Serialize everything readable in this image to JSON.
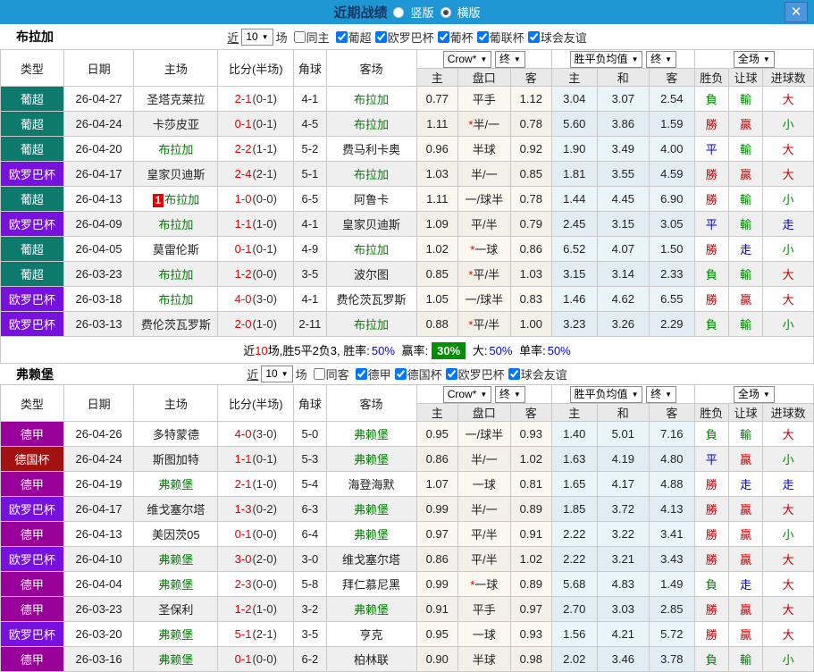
{
  "titlebar": {
    "title": "近期战绩",
    "vertical_label": "竖版",
    "horizontal_label": "横版",
    "close_glyph": "✕"
  },
  "labels": {
    "near": "近",
    "games": "场"
  },
  "dropdowns": {
    "bookmaker": "Crow*",
    "final_a": "终",
    "avg": "胜平负均值",
    "final_b": "终",
    "scope": "全场"
  },
  "columns": {
    "type": "类型",
    "date": "日期",
    "home": "主场",
    "score": "比分(半场)",
    "corner": "角球",
    "away": "客场",
    "o_home": "主",
    "o_hcap": "盘口",
    "o_away": "客",
    "e_home": "主",
    "e_draw": "和",
    "e_away": "客",
    "r_wdl": "胜负",
    "r_hcap": "让球",
    "r_goals": "进球数"
  },
  "league_colors": {
    "葡超": "#0E7A6E",
    "欧罗巴杯": "#7711DD",
    "德甲": "#990099",
    "德国杯": "#A31212"
  },
  "result_colors": {
    "勝": "#CC0000",
    "贏": "#CC0000",
    "大": "#CC0000",
    "負": "#008800",
    "輸": "#008800",
    "小": "#008800",
    "平": "#0000CC",
    "走": "#0000CC"
  },
  "sections": [
    {
      "team": "布拉加",
      "filter": {
        "count": "10",
        "same": "同主",
        "same_checked": false,
        "leagues": [
          {
            "label": "葡超",
            "checked": true
          },
          {
            "label": "欧罗巴杯",
            "checked": true
          },
          {
            "label": "葡杯",
            "checked": true
          },
          {
            "label": "葡联杯",
            "checked": true
          },
          {
            "label": "球会友谊",
            "checked": true
          }
        ]
      },
      "rows": [
        {
          "league": "葡超",
          "date": "26-04-27",
          "home": "圣塔克莱拉",
          "away": "布拉加",
          "ft": "2-1",
          "ht": "0-1",
          "corner": "4-1",
          "o": [
            "0.77",
            "平手",
            "1.12"
          ],
          "e": [
            "3.04",
            "3.07",
            "2.54"
          ],
          "res": [
            "負",
            "輸",
            "大"
          ]
        },
        {
          "league": "葡超",
          "date": "26-04-24",
          "home": "卡莎皮亚",
          "away": "布拉加",
          "ft": "0-1",
          "ht": "0-1",
          "corner": "4-5",
          "o": [
            "1.11",
            "*半/一",
            "0.78"
          ],
          "e": [
            "5.60",
            "3.86",
            "1.59"
          ],
          "res": [
            "勝",
            "贏",
            "小"
          ]
        },
        {
          "league": "葡超",
          "date": "26-04-20",
          "home": "布拉加",
          "away": "费马利卡奥",
          "ft": "2-2",
          "ht": "1-1",
          "corner": "5-2",
          "o": [
            "0.96",
            "半球",
            "0.92"
          ],
          "e": [
            "1.90",
            "3.49",
            "4.00"
          ],
          "res": [
            "平",
            "輸",
            "大"
          ]
        },
        {
          "league": "欧罗巴杯",
          "date": "26-04-17",
          "home": "皇家贝迪斯",
          "away": "布拉加",
          "ft": "2-4",
          "ht": "2-1",
          "corner": "5-1",
          "o": [
            "1.03",
            "半/一",
            "0.85"
          ],
          "e": [
            "1.81",
            "3.55",
            "4.59"
          ],
          "res": [
            "勝",
            "贏",
            "大"
          ]
        },
        {
          "league": "葡超",
          "date": "26-04-13",
          "home": "布拉加",
          "home_mark": "1",
          "away": "阿鲁卡",
          "ft": "1-0",
          "ht": "0-0",
          "corner": "6-5",
          "o": [
            "1.11",
            "一/球半",
            "0.78"
          ],
          "e": [
            "1.44",
            "4.45",
            "6.90"
          ],
          "res": [
            "勝",
            "輸",
            "小"
          ]
        },
        {
          "league": "欧罗巴杯",
          "date": "26-04-09",
          "home": "布拉加",
          "away": "皇家贝迪斯",
          "ft": "1-1",
          "ht": "1-0",
          "corner": "4-1",
          "o": [
            "1.09",
            "平/半",
            "0.79"
          ],
          "e": [
            "2.45",
            "3.15",
            "3.05"
          ],
          "res": [
            "平",
            "輸",
            "走"
          ]
        },
        {
          "league": "葡超",
          "date": "26-04-05",
          "home": "莫雷伦斯",
          "away": "布拉加",
          "ft": "0-1",
          "ht": "0-1",
          "corner": "4-9",
          "o": [
            "1.02",
            "*一球",
            "0.86"
          ],
          "e": [
            "6.52",
            "4.07",
            "1.50"
          ],
          "res": [
            "勝",
            "走",
            "小"
          ]
        },
        {
          "league": "葡超",
          "date": "26-03-23",
          "home": "布拉加",
          "away": "波尔图",
          "ft": "1-2",
          "ht": "0-0",
          "corner": "3-5",
          "o": [
            "0.85",
            "*平/半",
            "1.03"
          ],
          "e": [
            "3.15",
            "3.14",
            "2.33"
          ],
          "res": [
            "負",
            "輸",
            "大"
          ]
        },
        {
          "league": "欧罗巴杯",
          "date": "26-03-18",
          "home": "布拉加",
          "away": "费伦茨瓦罗斯",
          "ft": "4-0",
          "ht": "3-0",
          "corner": "4-1",
          "o": [
            "1.05",
            "一/球半",
            "0.83"
          ],
          "e": [
            "1.46",
            "4.62",
            "6.55"
          ],
          "res": [
            "勝",
            "贏",
            "大"
          ]
        },
        {
          "league": "欧罗巴杯",
          "date": "26-03-13",
          "home": "费伦茨瓦罗斯",
          "away": "布拉加",
          "ft": "2-0",
          "ht": "1-0",
          "corner": "2-11",
          "o": [
            "0.88",
            "*平/半",
            "1.00"
          ],
          "e": [
            "3.23",
            "3.26",
            "2.29"
          ],
          "res": [
            "負",
            "輸",
            "小"
          ]
        }
      ],
      "summary": {
        "p1": "近",
        "count": "10",
        "p2": "场,胜5平2负3, 胜率:",
        "v1": "50%",
        "p3": "赢率:",
        "badge": "30%",
        "p4": "大:",
        "v2": "50%",
        "p5": "单率:",
        "v3": "50%"
      }
    },
    {
      "team": "弗赖堡",
      "filter": {
        "count": "10",
        "same": "同客",
        "same_checked": false,
        "leagues": [
          {
            "label": "德甲",
            "checked": true
          },
          {
            "label": "德国杯",
            "checked": true
          },
          {
            "label": "欧罗巴杯",
            "checked": true
          },
          {
            "label": "球会友谊",
            "checked": true
          }
        ]
      },
      "rows": [
        {
          "league": "德甲",
          "date": "26-04-26",
          "home": "多特蒙德",
          "away": "弗赖堡",
          "ft": "4-0",
          "ht": "3-0",
          "corner": "5-0",
          "o": [
            "0.95",
            "一/球半",
            "0.93"
          ],
          "e": [
            "1.40",
            "5.01",
            "7.16"
          ],
          "res": [
            "負",
            "輸",
            "大"
          ]
        },
        {
          "league": "德国杯",
          "date": "26-04-24",
          "home": "斯图加特",
          "away": "弗赖堡",
          "ft": "1-1",
          "ht": "0-1",
          "corner": "5-3",
          "o": [
            "0.86",
            "半/一",
            "1.02"
          ],
          "e": [
            "1.63",
            "4.19",
            "4.80"
          ],
          "res": [
            "平",
            "贏",
            "小"
          ]
        },
        {
          "league": "德甲",
          "date": "26-04-19",
          "home": "弗赖堡",
          "away": "海登海默",
          "ft": "2-1",
          "ht": "1-0",
          "corner": "5-4",
          "o": [
            "1.07",
            "一球",
            "0.81"
          ],
          "e": [
            "1.65",
            "4.17",
            "4.88"
          ],
          "res": [
            "勝",
            "走",
            "走"
          ]
        },
        {
          "league": "欧罗巴杯",
          "date": "26-04-17",
          "home": "维戈塞尔塔",
          "away": "弗赖堡",
          "ft": "1-3",
          "ht": "0-2",
          "corner": "6-3",
          "o": [
            "0.99",
            "半/一",
            "0.89"
          ],
          "e": [
            "1.85",
            "3.72",
            "4.13"
          ],
          "res": [
            "勝",
            "贏",
            "大"
          ]
        },
        {
          "league": "德甲",
          "date": "26-04-13",
          "home": "美因茨05",
          "away": "弗赖堡",
          "ft": "0-1",
          "ht": "0-0",
          "corner": "6-4",
          "o": [
            "0.97",
            "平/半",
            "0.91"
          ],
          "e": [
            "2.22",
            "3.22",
            "3.41"
          ],
          "res": [
            "勝",
            "贏",
            "小"
          ]
        },
        {
          "league": "欧罗巴杯",
          "date": "26-04-10",
          "home": "弗赖堡",
          "away": "维戈塞尔塔",
          "ft": "3-0",
          "ht": "2-0",
          "corner": "3-0",
          "o": [
            "0.86",
            "平/半",
            "1.02"
          ],
          "e": [
            "2.22",
            "3.21",
            "3.43"
          ],
          "res": [
            "勝",
            "贏",
            "大"
          ]
        },
        {
          "league": "德甲",
          "date": "26-04-04",
          "home": "弗赖堡",
          "away": "拜仁慕尼黑",
          "ft": "2-3",
          "ht": "0-0",
          "corner": "5-8",
          "o": [
            "0.99",
            "*一球",
            "0.89"
          ],
          "e": [
            "5.68",
            "4.83",
            "1.49"
          ],
          "res": [
            "負",
            "走",
            "大"
          ]
        },
        {
          "league": "德甲",
          "date": "26-03-23",
          "home": "圣保利",
          "away": "弗赖堡",
          "ft": "1-2",
          "ht": "1-0",
          "corner": "3-2",
          "o": [
            "0.91",
            "平手",
            "0.97"
          ],
          "e": [
            "2.70",
            "3.03",
            "2.85"
          ],
          "res": [
            "勝",
            "贏",
            "大"
          ]
        },
        {
          "league": "欧罗巴杯",
          "date": "26-03-20",
          "home": "弗赖堡",
          "away": "亨克",
          "ft": "5-1",
          "ht": "2-1",
          "corner": "3-5",
          "o": [
            "0.95",
            "一球",
            "0.93"
          ],
          "e": [
            "1.56",
            "4.21",
            "5.72"
          ],
          "res": [
            "勝",
            "贏",
            "大"
          ]
        },
        {
          "league": "德甲",
          "date": "26-03-16",
          "home": "弗赖堡",
          "away": "柏林联",
          "ft": "0-1",
          "ht": "0-0",
          "corner": "6-2",
          "o": [
            "0.90",
            "半球",
            "0.98"
          ],
          "e": [
            "2.02",
            "3.46",
            "3.78"
          ],
          "res": [
            "負",
            "輸",
            "小"
          ]
        }
      ]
    }
  ]
}
